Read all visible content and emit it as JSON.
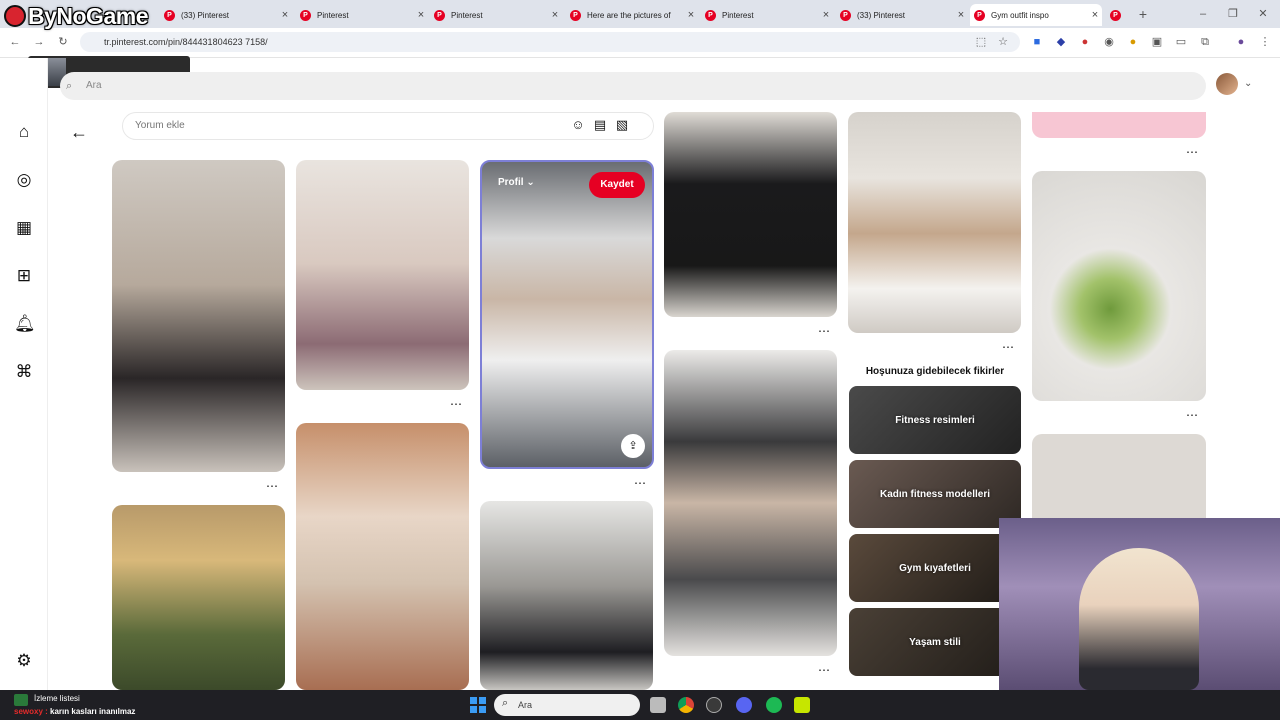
{
  "logo": {
    "text": "ByNoGame"
  },
  "tabs": [
    {
      "label": "",
      "x": 20
    },
    {
      "label": "(33) Pinterest"
    },
    {
      "label": "Pinterest"
    },
    {
      "label": "Pinterest"
    },
    {
      "label": "Here are the pictures of"
    },
    {
      "label": "Pinterest"
    },
    {
      "label": "(33) Pinterest"
    },
    {
      "label": "Gym outfit inspo"
    }
  ],
  "browser": {
    "url": "tr.pinterest.com/pin/844431804623 7158/",
    "new_tab_icon": "plus-icon"
  },
  "header": {
    "search_placeholder": "Ara"
  },
  "comment": {
    "placeholder": "Yorum ekle"
  },
  "pin_overlay": {
    "profile_label": "Profil",
    "save_label": "Kaydet"
  },
  "ideas": {
    "title": "Hoşunuza gidebilecek fikirler",
    "items": [
      {
        "label": "Fitness resimleri"
      },
      {
        "label": "Kadın fitness modelleri"
      },
      {
        "label": "Gym kıyafetleri"
      },
      {
        "label": "Yaşam stili"
      }
    ]
  },
  "taskbar": {
    "search_placeholder": "Ara",
    "watchlist": "İzleme listesi",
    "chat_name": "sewoxy :",
    "chat_message": "karın kasları inanılmaz"
  },
  "colors": {
    "pinterest_red": "#e60023",
    "tabbar_bg": "#dfe3eb",
    "taskbar_bg": "#1f1f24"
  }
}
